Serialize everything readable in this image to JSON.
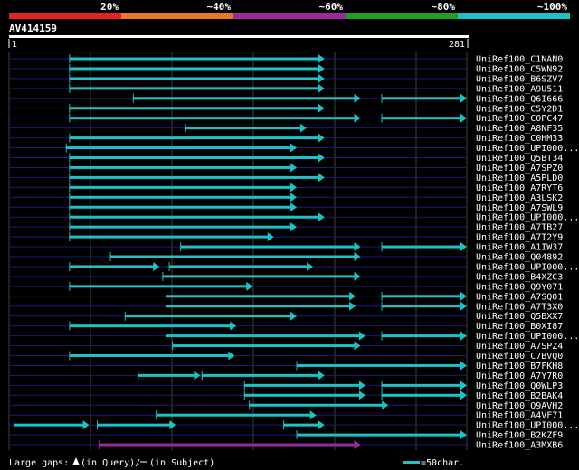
{
  "chart_data": {
    "type": "alignment",
    "query": {
      "name": "AV414159",
      "start": 1,
      "end": 281
    },
    "identity_legend": [
      {
        "label": "20%",
        "color": "#e8202a"
      },
      {
        "label": "~40%",
        "color": "#e87820"
      },
      {
        "label": "~60%",
        "color": "#9a2a9a"
      },
      {
        "label": "~80%",
        "color": "#20a020"
      },
      {
        "label": "~100%",
        "color": "#20c0c8"
      }
    ],
    "hits": [
      {
        "name": "UniRef100_C1NAN0",
        "color": "#20c0c8",
        "segments": [
          [
            38,
            194
          ]
        ]
      },
      {
        "name": "UniRef100_C5WN92",
        "color": "#20c0c8",
        "segments": [
          [
            38,
            194
          ]
        ]
      },
      {
        "name": "UniRef100_B6SZV7",
        "color": "#20c0c8",
        "segments": [
          [
            38,
            194
          ]
        ]
      },
      {
        "name": "UniRef100_A9U511",
        "color": "#20c0c8",
        "segments": [
          [
            38,
            194
          ]
        ]
      },
      {
        "name": "UniRef100_Q6I666",
        "color": "#20c0c8",
        "segments": [
          [
            77,
            216
          ],
          [
            229,
            281
          ]
        ]
      },
      {
        "name": "UniRef100_C5Y2D1",
        "color": "#20c0c8",
        "segments": [
          [
            38,
            194
          ]
        ]
      },
      {
        "name": "UniRef100_C0PC47",
        "color": "#20c0c8",
        "segments": [
          [
            38,
            216
          ],
          [
            229,
            281
          ]
        ]
      },
      {
        "name": "UniRef100_A8NF35",
        "color": "#20c0c8",
        "segments": [
          [
            109,
            183
          ]
        ]
      },
      {
        "name": "UniRef100_C0HM33",
        "color": "#20c0c8",
        "segments": [
          [
            38,
            194
          ]
        ]
      },
      {
        "name": "UniRef100_UPI000...",
        "color": "#20c0c8",
        "segments": [
          [
            36,
            177
          ]
        ]
      },
      {
        "name": "UniRef100_Q5BT34",
        "color": "#20c0c8",
        "segments": [
          [
            38,
            194
          ]
        ]
      },
      {
        "name": "UniRef100_A7SPZ0",
        "color": "#20c0c8",
        "segments": [
          [
            38,
            177
          ]
        ]
      },
      {
        "name": "UniRef100_A5PLD0",
        "color": "#20c0c8",
        "segments": [
          [
            38,
            194
          ]
        ]
      },
      {
        "name": "UniRef100_A7RYT6",
        "color": "#20c0c8",
        "segments": [
          [
            38,
            177
          ]
        ]
      },
      {
        "name": "UniRef100_A3LSK2",
        "color": "#20c0c8",
        "segments": [
          [
            38,
            177
          ]
        ]
      },
      {
        "name": "UniRef100_A7SWL9",
        "color": "#20c0c8",
        "segments": [
          [
            38,
            177
          ]
        ]
      },
      {
        "name": "UniRef100_UPI000...",
        "color": "#20c0c8",
        "segments": [
          [
            38,
            194
          ]
        ]
      },
      {
        "name": "UniRef100_A7TB27",
        "color": "#20c0c8",
        "segments": [
          [
            38,
            177
          ]
        ]
      },
      {
        "name": "UniRef100_A7T2Y9",
        "color": "#20c0c8",
        "segments": [
          [
            38,
            163
          ]
        ]
      },
      {
        "name": "UniRef100_A1IW37",
        "color": "#20c0c8",
        "segments": [
          [
            106,
            216
          ],
          [
            229,
            281
          ]
        ]
      },
      {
        "name": "UniRef100_Q04892",
        "color": "#20c0c8",
        "segments": [
          [
            63,
            216
          ]
        ]
      },
      {
        "name": "UniRef100_UPI000...",
        "color": "#20c0c8",
        "segments": [
          [
            38,
            93
          ],
          [
            99,
            187
          ]
        ]
      },
      {
        "name": "UniRef100_B4XZC3",
        "color": "#20c0c8",
        "segments": [
          [
            95,
            216
          ]
        ]
      },
      {
        "name": "UniRef100_Q9Y071",
        "color": "#20c0c8",
        "segments": [
          [
            38,
            150
          ]
        ]
      },
      {
        "name": "UniRef100_A7SQ01",
        "color": "#20c0c8",
        "segments": [
          [
            97,
            213
          ],
          [
            229,
            281
          ]
        ]
      },
      {
        "name": "UniRef100_A7T3X0",
        "color": "#20c0c8",
        "segments": [
          [
            97,
            213
          ],
          [
            229,
            281
          ]
        ]
      },
      {
        "name": "UniRef100_Q5BXX7",
        "color": "#20c0c8",
        "segments": [
          [
            72,
            177
          ]
        ]
      },
      {
        "name": "UniRef100_B0XI87",
        "color": "#20c0c8",
        "segments": [
          [
            38,
            140
          ]
        ]
      },
      {
        "name": "UniRef100_UPI000...",
        "color": "#20c0c8",
        "segments": [
          [
            97,
            219
          ],
          [
            229,
            281
          ]
        ]
      },
      {
        "name": "UniRef100_A7SPZ4",
        "color": "#20c0c8",
        "segments": [
          [
            101,
            216
          ]
        ]
      },
      {
        "name": "UniRef100_C7BVQ0",
        "color": "#20c0c8",
        "segments": [
          [
            38,
            139
          ]
        ]
      },
      {
        "name": "UniRef100_B7FKH8",
        "color": "#20c0c8",
        "segments": [
          [
            177,
            281
          ]
        ]
      },
      {
        "name": "UniRef100_A7Y7R0",
        "color": "#20c0c8",
        "segments": [
          [
            80,
            118
          ],
          [
            119,
            194
          ]
        ]
      },
      {
        "name": "UniRef100_Q0WLP3",
        "color": "#20c0c8",
        "segments": [
          [
            145,
            219
          ],
          [
            229,
            281
          ]
        ]
      },
      {
        "name": "UniRef100_B2BAK4",
        "color": "#20c0c8",
        "segments": [
          [
            145,
            219
          ],
          [
            229,
            281
          ]
        ]
      },
      {
        "name": "UniRef100_Q9AVH2",
        "color": "#20c0c8",
        "segments": [
          [
            148,
            233
          ]
        ]
      },
      {
        "name": "UniRef100_A4VF71",
        "color": "#20c0c8",
        "segments": [
          [
            91,
            189
          ]
        ]
      },
      {
        "name": "UniRef100_UPI000...",
        "color": "#20c0c8",
        "segments": [
          [
            4,
            50
          ],
          [
            55,
            103
          ],
          [
            169,
            194
          ]
        ]
      },
      {
        "name": "UniRef100_B2KZF9",
        "color": "#20c0c8",
        "segments": [
          [
            177,
            281
          ]
        ]
      },
      {
        "name": "UniRef100_A3MXB6",
        "color": "#9a2a9a",
        "segments": [
          [
            56,
            216
          ]
        ]
      }
    ],
    "footer": {
      "gaps_label": "Large gaps:",
      "query_gap": "(in Query)/",
      "subject_gap": "(in Subject)",
      "scale_label": "=50char."
    }
  }
}
